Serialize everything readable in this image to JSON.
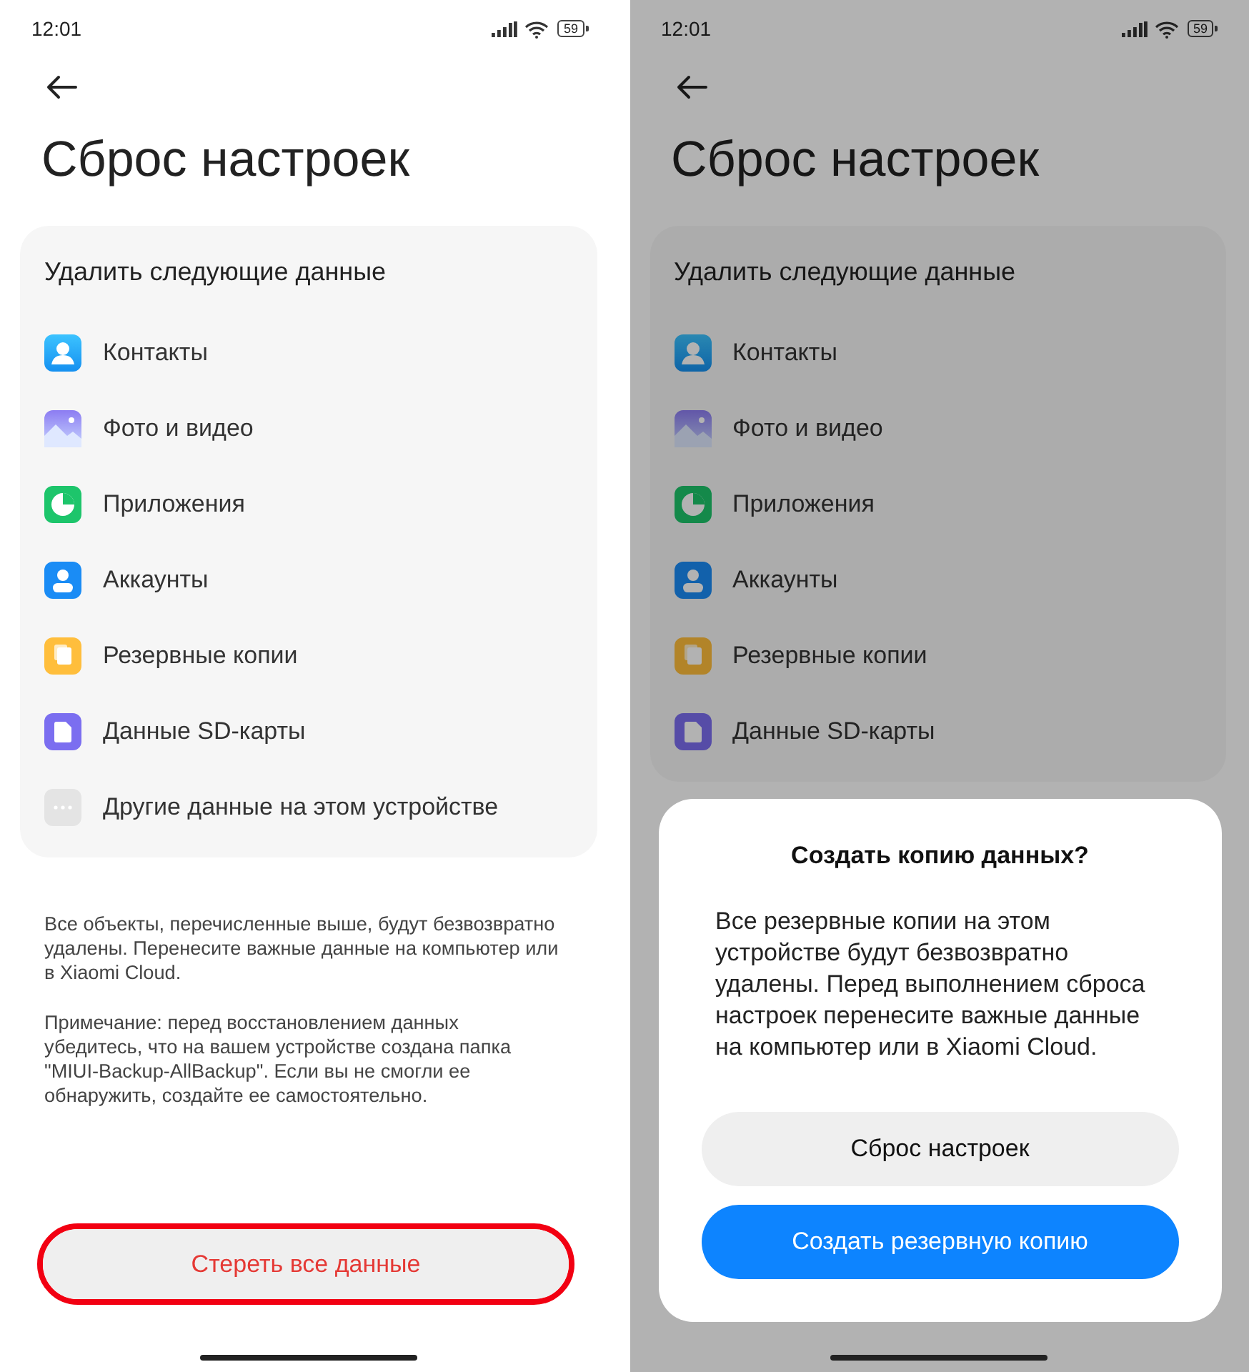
{
  "screens": [
    {
      "status_bar": {
        "time": "12:01",
        "battery": "59"
      },
      "title": "Сброс настроек",
      "dimmed": false,
      "section": {
        "title": "Удалить следующие данные",
        "items": [
          {
            "label": "Контакты",
            "kind": "contacts"
          },
          {
            "label": "Фото и видео",
            "kind": "photos"
          },
          {
            "label": "Приложения",
            "kind": "apps"
          },
          {
            "label": "Аккаунты",
            "kind": "accounts"
          },
          {
            "label": "Резервные копии",
            "kind": "backups"
          },
          {
            "label": "Данные SD-карты",
            "kind": "sdcard"
          },
          {
            "label": "Другие данные на этом устройстве",
            "kind": "other"
          }
        ]
      },
      "notes": [
        "Все объекты, перечисленные выше, будут безвозвратно удалены. Перенесите важные данные на компьютер или в Xiaomi Cloud.",
        "Примечание: перед восстановлением данных убедитесь, что на вашем устройстве создана папка \"MIUI-Backup-AllBackup\". Если вы не смогли ее обнаружить, создайте ее самостоятельно."
      ],
      "button": {
        "label": "Стереть все данные",
        "highlighted": true
      }
    },
    {
      "status_bar": {
        "time": "12:01",
        "battery": "59"
      },
      "title": "Сброс настроек",
      "dimmed": true,
      "section": {
        "title": "Удалить следующие данные",
        "items": [
          {
            "label": "Контакты",
            "kind": "contacts"
          },
          {
            "label": "Фото и видео",
            "kind": "photos"
          },
          {
            "label": "Приложения",
            "kind": "apps"
          },
          {
            "label": "Аккаунты",
            "kind": "accounts"
          },
          {
            "label": "Резервные копии",
            "kind": "backups"
          },
          {
            "label": "Данные SD-карты",
            "kind": "sdcard"
          }
        ]
      },
      "dialog": {
        "title": "Создать копию данных?",
        "message": "Все резервные копии на этом устройстве будут безвозвратно удалены. Перед выполнением сброса настроек перенесите важные данные на компьютер или в Xiaomi Cloud.",
        "buttons": [
          {
            "label": "Сброс настроек",
            "kind": "secondary"
          },
          {
            "label": "Создать резервную копию",
            "kind": "primary"
          }
        ]
      }
    }
  ]
}
